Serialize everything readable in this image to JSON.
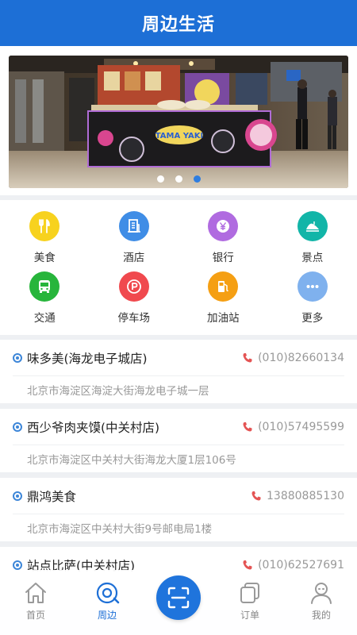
{
  "header": {
    "title": "周边生活"
  },
  "banner": {
    "sign_text": "TAMA YAKI",
    "active_slide": 3,
    "slide_count": 3
  },
  "categories": [
    {
      "label": "美食",
      "icon": "fork-knife-icon",
      "color": "#f7d21e"
    },
    {
      "label": "酒店",
      "icon": "building-icon",
      "color": "#3f8de6"
    },
    {
      "label": "银行",
      "icon": "yen-icon",
      "color": "#b06be0"
    },
    {
      "label": "景点",
      "icon": "scenic-icon",
      "color": "#12b5a8"
    },
    {
      "label": "交通",
      "icon": "bus-icon",
      "color": "#27b53b"
    },
    {
      "label": "停车场",
      "icon": "parking-icon",
      "color": "#f0494e"
    },
    {
      "label": "加油站",
      "icon": "gas-station-icon",
      "color": "#f59f13"
    },
    {
      "label": "更多",
      "icon": "more-icon",
      "color": "#7fb1ee"
    }
  ],
  "shops": [
    {
      "name": "味多美(海龙电子城店)",
      "phone": "(010)82660134",
      "address": "北京市海淀区海淀大街海龙电子城一层"
    },
    {
      "name": "西少爷肉夹馍(中关村店)",
      "phone": "(010)57495599",
      "address": "北京市海淀区中关村大街海龙大厦1层106号"
    },
    {
      "name": "鼎鸿美食",
      "phone": "13880885130",
      "address": "北京市海淀区中关村大街9号邮电局1楼"
    },
    {
      "name": "站点比萨(中关村店)",
      "phone": "(010)62527691",
      "address": ""
    }
  ],
  "tabbar": {
    "home": "首页",
    "nearby": "周边",
    "orders": "订单",
    "mine": "我的"
  },
  "colors": {
    "primary": "#1d6fd6",
    "bg": "#eef0f3"
  }
}
